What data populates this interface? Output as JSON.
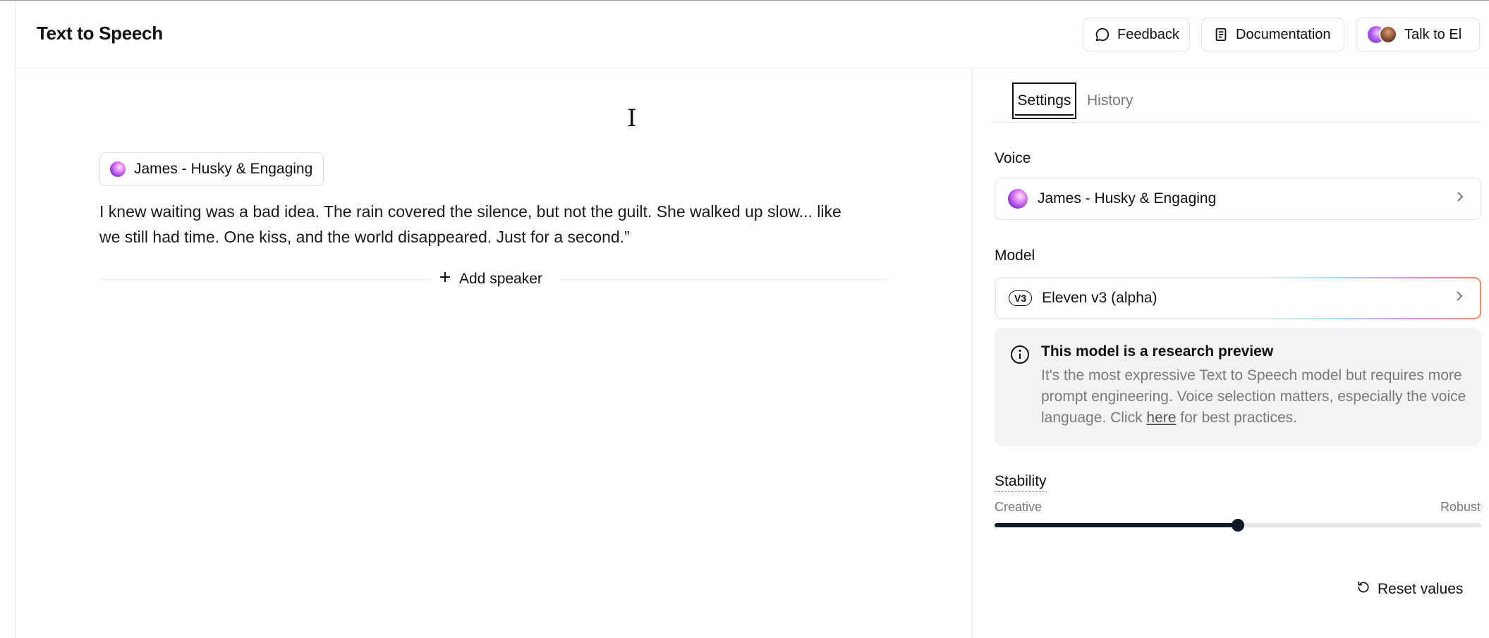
{
  "header": {
    "title": "Text to Speech",
    "feedback_label": "Feedback",
    "documentation_label": "Documentation",
    "talk_label": "Talk to El"
  },
  "editor": {
    "speaker": {
      "name": "James - Husky & Engaging"
    },
    "text": "I knew waiting was a bad idea. The rain covered the silence, but not the guilt. She walked up slow... like we still had time. One kiss, and the world disappeared. Just for a second.”",
    "add_speaker_label": "Add speaker"
  },
  "panel": {
    "tabs": [
      {
        "label": "Settings",
        "active": true
      },
      {
        "label": "History",
        "active": false
      }
    ],
    "voice": {
      "label": "Voice",
      "value": "James - Husky & Engaging"
    },
    "model": {
      "label": "Model",
      "badge": "V3",
      "value": "Eleven v3 (alpha)"
    },
    "notice": {
      "title": "This model is a research preview",
      "body_before": "It's the most expressive Text to Speech model but requires more prompt engineering. Voice selection matters, especially the voice language. Click ",
      "link": "here",
      "body_after": " for best practices."
    },
    "stability": {
      "label": "Stability",
      "min_label": "Creative",
      "max_label": "Robust",
      "value_fraction": 0.5
    },
    "reset_label": "Reset values"
  },
  "colors": {
    "accent_dark": "#111827",
    "muted_text": "#7a7a7a",
    "border": "#e3e3e3",
    "notice_bg": "#f3f3f3"
  },
  "icons": [
    "chat-bubble-icon",
    "document-icon",
    "avatar-pair",
    "text-cursor-icon",
    "voice-orb-icon",
    "plus-icon",
    "chevron-right-icon",
    "info-icon",
    "reset-icon"
  ]
}
